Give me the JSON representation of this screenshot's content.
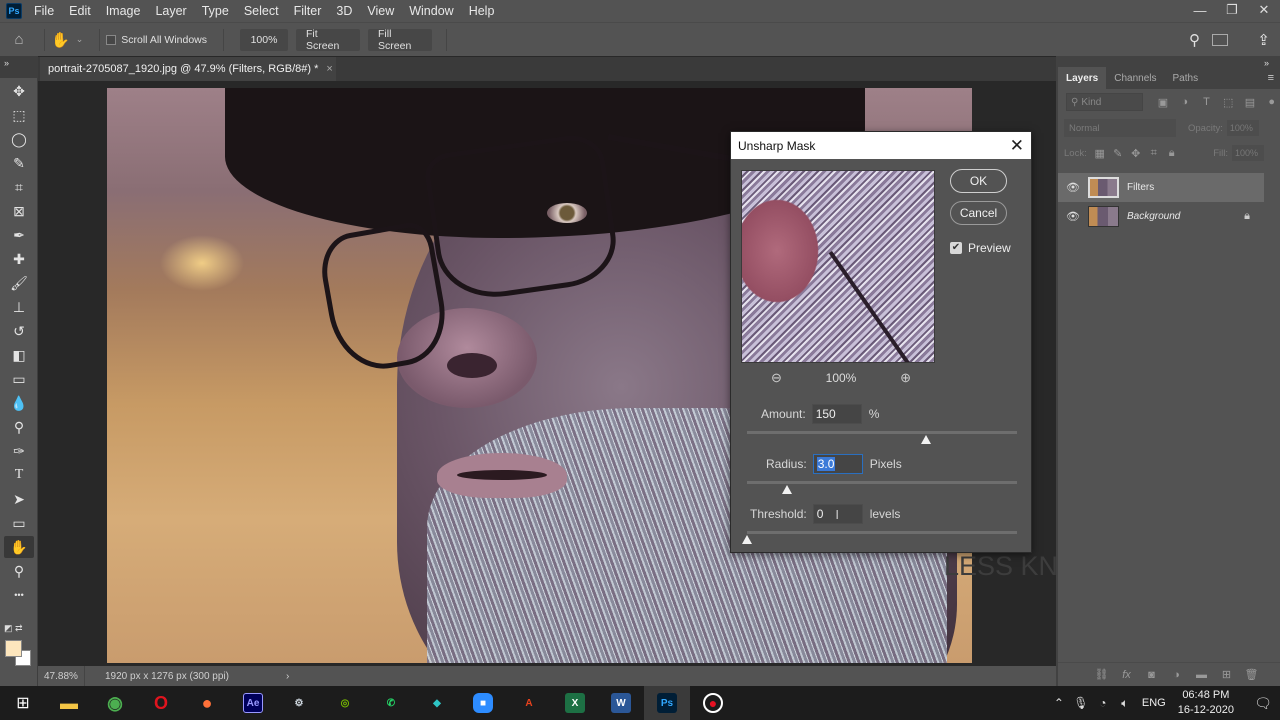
{
  "app": {
    "logo": "Ps",
    "menu": [
      "File",
      "Edit",
      "Image",
      "Layer",
      "Type",
      "Select",
      "Filter",
      "3D",
      "View",
      "Window",
      "Help"
    ],
    "window_controls": {
      "minimize": "—",
      "restore": "❐",
      "close": "✕"
    }
  },
  "options_bar": {
    "scroll_all_windows": {
      "label": "Scroll All Windows",
      "checked": false
    },
    "zoom_100_label": "100%",
    "fit_screen_label": "Fit Screen",
    "fill_screen_label": "Fill Screen"
  },
  "tools": [
    {
      "name": "move",
      "glyph": "✥"
    },
    {
      "name": "marquee",
      "glyph": "⬚"
    },
    {
      "name": "lasso",
      "glyph": "◯"
    },
    {
      "name": "quick-select",
      "glyph": "✎"
    },
    {
      "name": "crop",
      "glyph": "⌗"
    },
    {
      "name": "frame",
      "glyph": "⊠"
    },
    {
      "name": "eyedropper",
      "glyph": "✒"
    },
    {
      "name": "healing-brush",
      "glyph": "✚"
    },
    {
      "name": "brush",
      "glyph": "🖌"
    },
    {
      "name": "clone-stamp",
      "glyph": "⊥"
    },
    {
      "name": "history-brush",
      "glyph": "↺"
    },
    {
      "name": "eraser",
      "glyph": "◧"
    },
    {
      "name": "gradient",
      "glyph": "▭"
    },
    {
      "name": "blur",
      "glyph": "💧"
    },
    {
      "name": "dodge",
      "glyph": "⚲"
    },
    {
      "name": "pen",
      "glyph": "✑"
    },
    {
      "name": "type",
      "glyph": "T"
    },
    {
      "name": "path-selection",
      "glyph": "➤"
    },
    {
      "name": "rectangle",
      "glyph": "▭"
    },
    {
      "name": "hand",
      "glyph": "✋",
      "active": true
    },
    {
      "name": "zoom",
      "glyph": "⚲"
    },
    {
      "name": "more",
      "glyph": "•••"
    }
  ],
  "colors": {
    "foreground": "#fde6bd",
    "background": "#ffffff",
    "accent": "#31a8ff",
    "selection": "#3b7ad8"
  },
  "document": {
    "tab_title": "portrait-2705087_1920.jpg @ 47.9% (Filters, RGB/8#) *",
    "close_glyph": "×",
    "watermark": "LESS KNOWLEDGE"
  },
  "status": {
    "zoom": "47.88%",
    "doc_info": "1920 px x 1276 px (300 ppi)",
    "arrow": "›"
  },
  "layers_panel": {
    "tabs": [
      "Layers",
      "Channels",
      "Paths"
    ],
    "active_tab": "Layers",
    "kind_placeholder": "Kind",
    "blend_mode": "Normal",
    "opacity_label": "Opacity:",
    "opacity_value": "100%",
    "lock_label": "Lock:",
    "fill_label": "Fill:",
    "fill_value": "100%",
    "layers": [
      {
        "name": "Filters",
        "visible": true,
        "selected": true,
        "italic": false,
        "locked": false
      },
      {
        "name": "Background",
        "visible": true,
        "selected": false,
        "italic": true,
        "locked": true
      }
    ]
  },
  "dialog": {
    "title": "Unsharp Mask",
    "ok_label": "OK",
    "cancel_label": "Cancel",
    "preview_label": "Preview",
    "preview_checked": true,
    "preview_zoom": "100%",
    "amount": {
      "label": "Amount:",
      "value": "150",
      "unit": "%",
      "slider_fraction": 0.3
    },
    "radius": {
      "label": "Radius:",
      "value": "3.0",
      "unit": "Pixels",
      "slider_fraction": 0.012
    },
    "threshold": {
      "label": "Threshold:",
      "value": "0",
      "unit": "levels",
      "slider_fraction": 0.0
    }
  },
  "taskbar": {
    "apps": [
      {
        "name": "file-explorer",
        "glyph": "▬",
        "color": "#f3c545"
      },
      {
        "name": "chrome",
        "glyph": "◉",
        "color": "#4caf50"
      },
      {
        "name": "opera",
        "glyph": "O",
        "color": "#e0141e"
      },
      {
        "name": "firefox",
        "glyph": "●",
        "color": "#ff7139"
      },
      {
        "name": "after-effects",
        "glyph": "Ae",
        "color": "#9999ff"
      },
      {
        "name": "app-settings",
        "glyph": "⚙",
        "color": "#cfd8e0"
      },
      {
        "name": "nvidia",
        "glyph": "◎",
        "color": "#76b900"
      },
      {
        "name": "whatsapp",
        "glyph": "✆",
        "color": "#25d366"
      },
      {
        "name": "filmora",
        "glyph": "◆",
        "color": "#2ec5c5"
      },
      {
        "name": "zoom",
        "glyph": "■",
        "color": "#2d8cff"
      },
      {
        "name": "acrobat",
        "glyph": "A",
        "color": "#e8421d"
      },
      {
        "name": "excel",
        "glyph": "X",
        "color": "#1d7044"
      },
      {
        "name": "word",
        "glyph": "W",
        "color": "#2b5797"
      },
      {
        "name": "photoshop",
        "glyph": "Ps",
        "color": "#31a8ff",
        "active": true
      },
      {
        "name": "recorder",
        "glyph": "●",
        "color": "#e81123"
      }
    ],
    "tray": {
      "language": "ENG",
      "time": "06:48 PM",
      "date": "16-12-2020"
    }
  }
}
